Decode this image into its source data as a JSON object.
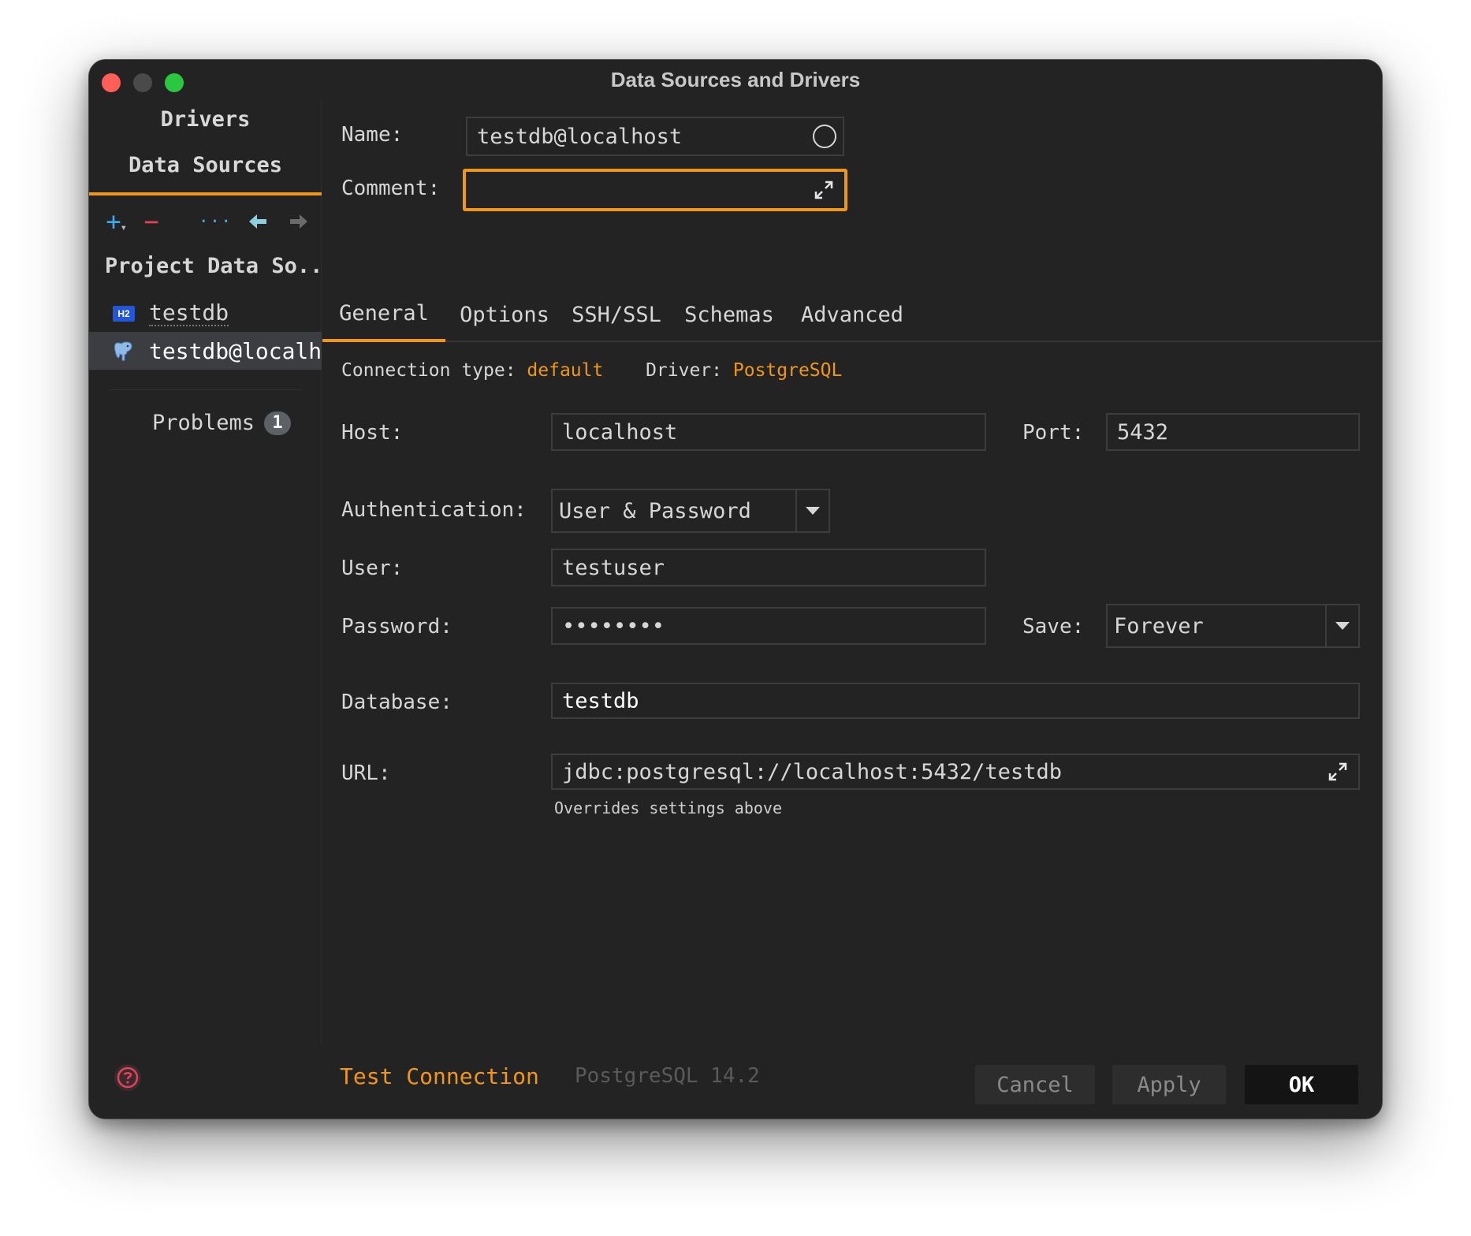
{
  "window": {
    "title": "Data Sources and Drivers"
  },
  "sidebar": {
    "tabs": {
      "drivers": "Drivers",
      "data_sources": "Data Sources"
    },
    "toolbar": {
      "add": "+",
      "remove": "−",
      "more": "···",
      "back": "🡄",
      "forward": "🡆"
    },
    "section_title": "Project Data So..",
    "items": [
      {
        "icon": "h2-icon",
        "label": "testdb"
      },
      {
        "icon": "postgresql-elephant-icon",
        "label": "testdb@localhost"
      }
    ],
    "problems": {
      "label": "Problems",
      "count": "1"
    }
  },
  "form": {
    "name": {
      "label": "Name:",
      "value": "testdb@localhost"
    },
    "comment": {
      "label": "Comment:",
      "value": ""
    },
    "tabs": [
      "General",
      "Options",
      "SSH/SSL",
      "Schemas",
      "Advanced"
    ],
    "connection": {
      "type_label": "Connection type:",
      "type_value": "default",
      "driver_label": "Driver:",
      "driver_value": "PostgreSQL"
    },
    "host": {
      "label": "Host:",
      "value": "localhost"
    },
    "port": {
      "label": "Port:",
      "value": "5432"
    },
    "authentication": {
      "label": "Authentication:",
      "value": "User & Password"
    },
    "user": {
      "label": "User:",
      "value": "testuser"
    },
    "password": {
      "label": "Password:",
      "value": "••••••••"
    },
    "save": {
      "label": "Save:",
      "value": "Forever"
    },
    "database": {
      "label": "Database:",
      "value": "testdb"
    },
    "url": {
      "label": "URL:",
      "value": "jdbc:postgresql://localhost:5432/testdb",
      "hint": "Overrides settings above"
    }
  },
  "footer": {
    "test_connection": "Test Connection",
    "version": "PostgreSQL 14.2",
    "buttons": {
      "cancel": "Cancel",
      "apply": "Apply",
      "ok": "OK"
    }
  },
  "colors": {
    "accent": "#f0961a",
    "background": "#232323",
    "close": "#ff5f57",
    "zoom": "#2ac840",
    "add": "#3fa9ef",
    "remove": "#e0435a"
  }
}
